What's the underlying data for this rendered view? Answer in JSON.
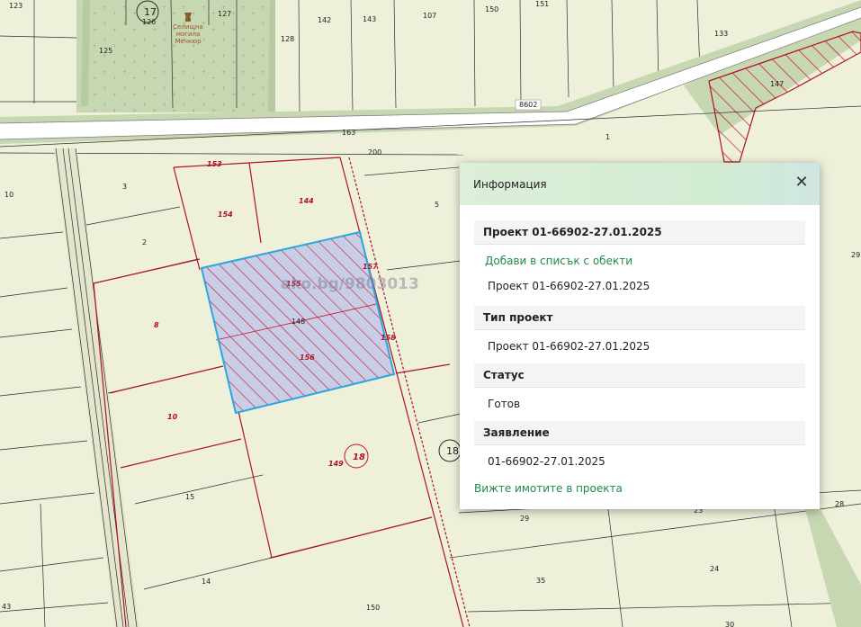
{
  "map": {
    "colors": {
      "background": "#eef0da",
      "parcel_line": "#2d2d2d",
      "road": "#ffffff",
      "green_zone": "#c6d7b1",
      "red_boundary": "#b0122a",
      "selection_fill": "#c9cde6",
      "selection_border": "#29a8e0"
    },
    "parcel_numbers": [
      "123",
      "17",
      "126",
      "127",
      "125",
      "128",
      "142",
      "143",
      "107",
      "150",
      "151",
      "133",
      "8602",
      "147",
      "163",
      "1",
      "200",
      "153",
      "3",
      "154",
      "144",
      "5",
      "10",
      "2",
      "29",
      "8",
      "148",
      "155",
      "156",
      "157",
      "158",
      "10",
      "18",
      "149",
      "15",
      "18",
      "28",
      "29",
      "23",
      "14",
      "35",
      "24",
      "43",
      "150",
      "30"
    ],
    "monument_label": [
      "Селищна",
      "могила",
      "Мечкюр"
    ],
    "watermark": "ako.bg/9803013"
  },
  "popup": {
    "title": "Информация",
    "close_icon": "close-icon",
    "project_header": "Проект 01-66902-27.01.2025",
    "add_link": "Добави в списък с обекти",
    "project_value": "Проект 01-66902-27.01.2025",
    "type_header": "Тип проект",
    "type_value": "Проект 01-66902-27.01.2025",
    "status_header": "Статус",
    "status_value": "Готов",
    "application_header": "Заявление",
    "application_value": "01-66902-27.01.2025",
    "view_link": "Вижте имотите в проекта"
  }
}
